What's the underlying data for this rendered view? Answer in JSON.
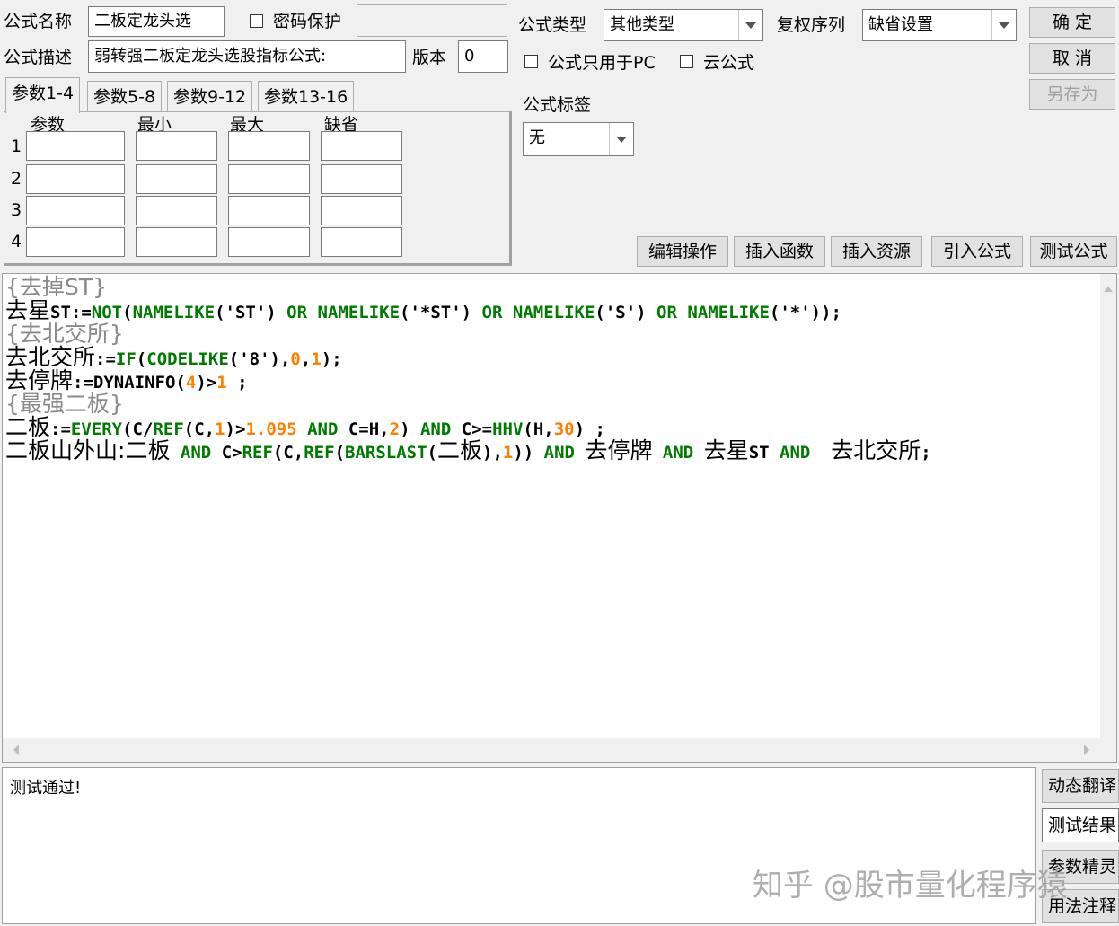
{
  "header": {
    "name_label": "公式名称",
    "name_value": "二板定龙头选",
    "password_label": "密码保护",
    "password_value": "",
    "desc_label": "公式描述",
    "desc_value": "弱转强二板定龙头选股指标公式:",
    "version_label": "版本",
    "version_value": "0",
    "type_label": "公式类型",
    "type_value": "其他类型",
    "fuquan_label": "复权序列",
    "fuquan_value": "缺省设置",
    "pc_only_label": "公式只用于PC",
    "cloud_label": "云公式",
    "tag_label": "公式标签",
    "tag_value": "无"
  },
  "buttons": {
    "ok": "确  定",
    "cancel": "取  消",
    "save_as": "另存为",
    "edit_ops": "编辑操作",
    "insert_func": "插入函数",
    "insert_res": "插入资源",
    "import_formula": "引入公式",
    "test_formula": "测试公式"
  },
  "params": {
    "tabs": [
      "参数1-4",
      "参数5-8",
      "参数9-12",
      "参数13-16"
    ],
    "columns": [
      "参数",
      "最小",
      "最大",
      "缺省"
    ],
    "rows": [
      "1",
      "2",
      "3",
      "4"
    ]
  },
  "code": {
    "l1": "{去掉ST}",
    "l2_a": "去星",
    "l2_b": "ST:=",
    "l2_c": "NOT",
    "l2_d": "(",
    "l2_e": "NAMELIKE",
    "l2_f": "('ST') ",
    "l2_g": "OR",
    "l2_h": " ",
    "l2_i": "NAMELIKE",
    "l2_j": "('*ST') ",
    "l2_k": "OR",
    "l2_l": " ",
    "l2_m": "NAMELIKE",
    "l2_n": "('S') ",
    "l2_o": "OR",
    "l2_p": " ",
    "l2_q": "NAMELIKE",
    "l2_r": "('*'));",
    "l3": "{去北交所}",
    "l4_a": "去北交所",
    "l4_b": ":=",
    "l4_c": "IF",
    "l4_d": "(",
    "l4_e": "CODELIKE",
    "l4_f": "('8'),",
    "l4_g": "0",
    "l4_h": ",",
    "l4_i": "1",
    "l4_j": ");",
    "l5_a": "去停牌",
    "l5_b": ":=DYNAINFO(",
    "l5_c": "4",
    "l5_d": ")>",
    "l5_e": "1",
    "l5_f": " ;",
    "l6": "{最强二板}",
    "l7_a": "二板",
    "l7_b": ":=",
    "l7_c": "EVERY",
    "l7_d": "(C/",
    "l7_e": "REF",
    "l7_f": "(C,",
    "l7_g": "1",
    "l7_h": ")>",
    "l7_i": "1.095",
    "l7_j": " ",
    "l7_k": "AND",
    "l7_l": " C=H,",
    "l7_m": "2",
    "l7_n": ") ",
    "l7_o": "AND",
    "l7_p": " C>=",
    "l7_q": "HHV",
    "l7_r": "(H,",
    "l7_s": "30",
    "l7_t": ") ;",
    "l8_a": "二板山外山",
    "l8_b": ":",
    "l8_c": "二板",
    "l8_d": " ",
    "l8_e": "AND",
    "l8_f": " C>",
    "l8_g": "REF",
    "l8_h": "(C,",
    "l8_i": "REF",
    "l8_j": "(",
    "l8_k": "BARSLAST",
    "l8_l": "(",
    "l8_m": "二板",
    "l8_n": "),",
    "l8_o": "1",
    "l8_p": ")) ",
    "l8_q": "AND",
    "l8_r": " ",
    "l8_s": "去停牌",
    "l8_t": " ",
    "l8_u": "AND",
    "l8_v": " ",
    "l8_w": "去星",
    "l8_x": "ST ",
    "l8_y": "AND",
    "l8_z": "  ",
    "l8_aa": "去北交所",
    "l8_ab": ";"
  },
  "output": {
    "message": "测试通过!"
  },
  "side_buttons": {
    "dynamic_translate": "动态翻译",
    "test_result": "测试结果",
    "param_wizard": "参数精灵",
    "usage_notes": "用法注释"
  },
  "watermark": "知乎 @股市量化程序猿"
}
